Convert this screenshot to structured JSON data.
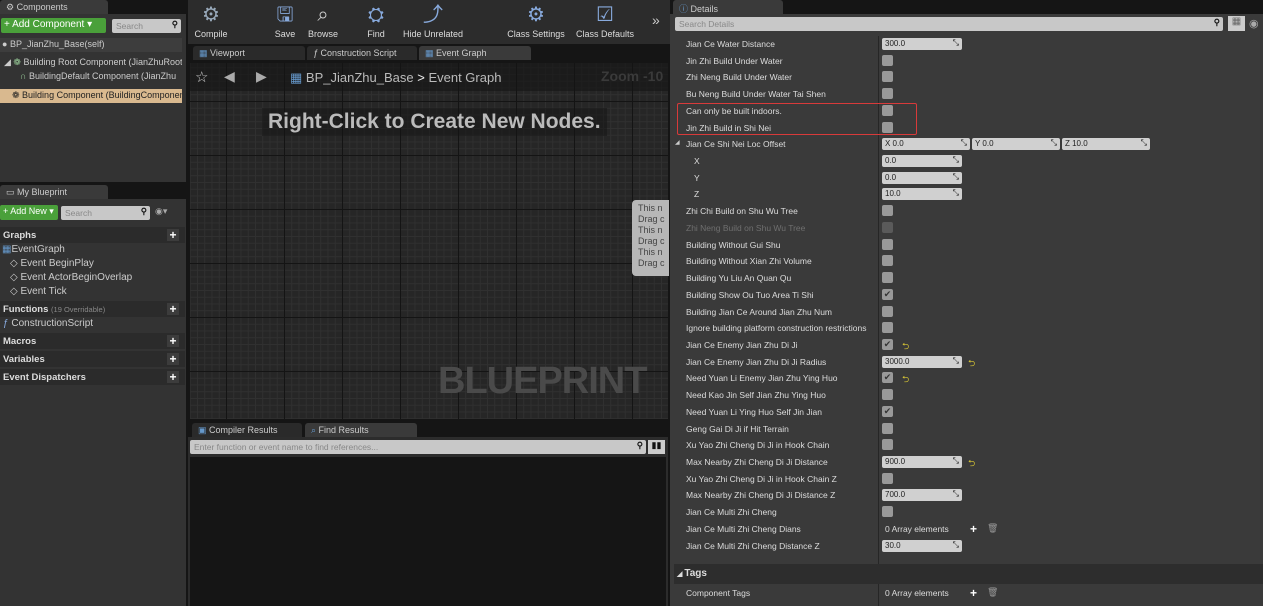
{
  "components": {
    "tab": "Components",
    "add_button": "+ Add Component ▾",
    "search_placeholder": "Search",
    "self": "BP_JianZhu_Base(self)",
    "items": [
      "Building Root Component (JianZhuRoot",
      "BuildingDefault Component (JianZhu",
      "Building Component (BuildingComponent"
    ]
  },
  "my_blueprint": {
    "tab": "My Blueprint",
    "add_button": "+ Add New ▾",
    "search_placeholder": "Search",
    "graphs": "Graphs",
    "event_graph": "EventGraph",
    "events": [
      "Event BeginPlay",
      "Event ActorBeginOverlap",
      "Event Tick"
    ],
    "functions": "Functions",
    "functions_count": "(19 Overridable)",
    "construction_script": "ConstructionScript",
    "macros": "Macros",
    "variables": "Variables",
    "dispatchers": "Event Dispatchers"
  },
  "toolbar": {
    "compile": "Compile",
    "save": "Save",
    "browse": "Browse",
    "find": "Find",
    "hide_unrelated": "Hide Unrelated",
    "class_settings": "Class Settings",
    "class_defaults": "Class Defaults"
  },
  "editor_tabs": [
    "Viewport",
    "Construction Script",
    "Event Graph"
  ],
  "graph": {
    "breadcrumb_root": "BP_JianZhu_Base",
    "breadcrumb_sep": ">",
    "breadcrumb_current": "Event Graph",
    "zoom": "Zoom -10",
    "hint": "Right-Click to Create New Nodes.",
    "watermark": "BLUEPRINT",
    "comment_lines": [
      "This n",
      "Drag c",
      "This n",
      "Drag c",
      "This n",
      "Drag c"
    ]
  },
  "bottom": {
    "tabs": [
      "Compiler Results",
      "Find Results"
    ],
    "find_placeholder": "Enter function or event name to find references..."
  },
  "details": {
    "tab": "Details",
    "search_placeholder": "Search Details",
    "rows": [
      {
        "label": "Jian Ce Water Distance",
        "type": "num",
        "value": "300.0"
      },
      {
        "label": "Jin Zhi Build Under Water",
        "type": "cb",
        "checked": false
      },
      {
        "label": "Zhi Neng Build Under Water",
        "type": "cb",
        "checked": false
      },
      {
        "label": "Bu Neng Build Under Water Tai Shen",
        "type": "cb",
        "checked": false
      },
      {
        "label": "Can only be built indoors.",
        "type": "cb",
        "checked": false,
        "highlighted": true
      },
      {
        "label": "Jin Zhi Build in Shi Nei",
        "type": "cb",
        "checked": false,
        "highlighted": true
      },
      {
        "label": "Jian Ce Shi Nei Loc Offset",
        "type": "vec",
        "x": "X  0.0",
        "y": "Y  0.0",
        "z": "Z  10.0"
      },
      {
        "label": "X",
        "type": "num",
        "value": "0.0",
        "sub": true
      },
      {
        "label": "Y",
        "type": "num",
        "value": "0.0",
        "sub": true
      },
      {
        "label": "Z",
        "type": "num",
        "value": "10.0",
        "sub": true
      },
      {
        "label": "Zhi Chi Build on Shu Wu Tree",
        "type": "cb",
        "checked": false
      },
      {
        "label": "Zhi Neng Build on Shu Wu Tree",
        "type": "cb",
        "checked": false,
        "disabled": true
      },
      {
        "label": "Building Without Gui Shu",
        "type": "cb",
        "checked": false
      },
      {
        "label": "Building Without Xian Zhi Volume",
        "type": "cb",
        "checked": false
      },
      {
        "label": "Building Yu Liu An Quan Qu",
        "type": "cb",
        "checked": false
      },
      {
        "label": "Building Show Ou Tuo Area Ti Shi",
        "type": "cb",
        "checked": true
      },
      {
        "label": "Building Jian Ce Around Jian Zhu Num",
        "type": "cb",
        "checked": false
      },
      {
        "label": "Ignore building platform construction restrictions",
        "type": "cb",
        "checked": false
      },
      {
        "label": "Jian Ce Enemy Jian Zhu Di Ji",
        "type": "cb",
        "checked": true,
        "reset": true
      },
      {
        "label": "Jian Ce Enemy Jian Zhu Di Ji Radius",
        "type": "num",
        "value": "3000.0",
        "reset": true
      },
      {
        "label": "Need Yuan Li Enemy Jian Zhu Ying Huo",
        "type": "cb",
        "checked": true,
        "reset": true
      },
      {
        "label": "Need Kao Jin Self Jian Zhu Ying Huo",
        "type": "cb",
        "checked": false
      },
      {
        "label": "Need Yuan Li Ying Huo Self Jin Jian",
        "type": "cb",
        "checked": true
      },
      {
        "label": "Geng Gai Di Ji if Hit Terrain",
        "type": "cb",
        "checked": false
      },
      {
        "label": "Xu Yao Zhi Cheng Di Ji in Hook Chain",
        "type": "cb",
        "checked": false
      },
      {
        "label": "Max Nearby Zhi Cheng Di Ji Distance",
        "type": "num",
        "value": "900.0",
        "reset": true
      },
      {
        "label": "Xu Yao Zhi Cheng Di Ji in Hook Chain Z",
        "type": "cb",
        "checked": false
      },
      {
        "label": "Max Nearby Zhi Cheng Di Ji Distance Z",
        "type": "num",
        "value": "700.0"
      },
      {
        "label": "Jian Ce Multi Zhi Cheng",
        "type": "cb",
        "checked": false
      },
      {
        "label": "Jian Ce Multi Zhi Cheng Dians",
        "type": "arr",
        "value": "0 Array elements"
      },
      {
        "label": "Jian Ce Multi Zhi Cheng Distance Z",
        "type": "num",
        "value": "30.0"
      }
    ],
    "tags_section": "Tags",
    "component_tags_label": "Component Tags",
    "component_tags_value": "0 Array elements"
  },
  "colors": {
    "accent_green": "#4aa03a",
    "highlight_red": "#d83a3a",
    "selected": "#d9b98f",
    "reset_yellow": "#d8c634"
  }
}
